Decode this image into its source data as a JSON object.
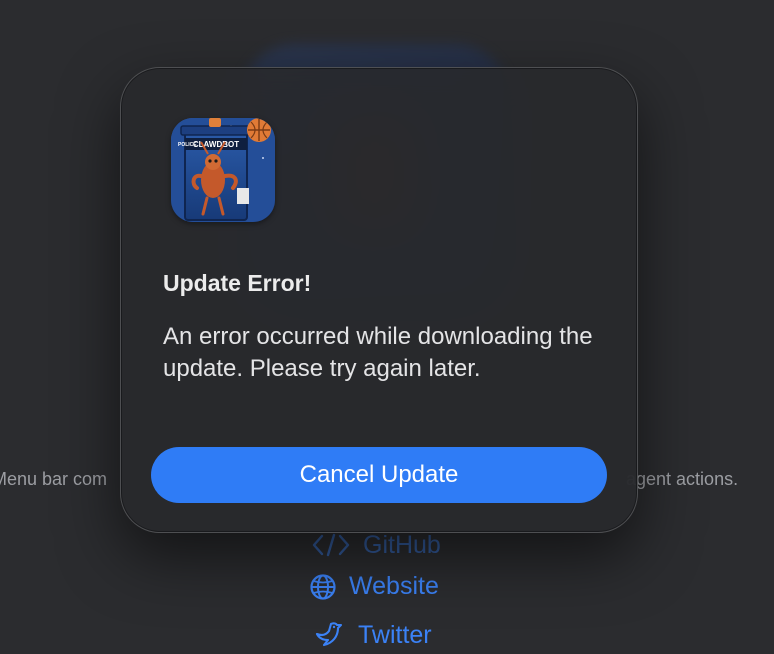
{
  "background": {
    "left_text": "Menu bar com",
    "right_text": "agent actions.",
    "links": [
      {
        "label": "GitHub",
        "icon": "code-icon"
      },
      {
        "label": "Website",
        "icon": "globe-icon"
      },
      {
        "label": "Twitter",
        "icon": "bird-icon"
      }
    ]
  },
  "dialog": {
    "icon": "clawdbot-app-icon",
    "icon_text": {
      "sign": "CLAWDBOT",
      "side": "POLICE"
    },
    "title": "Update Error!",
    "message": "An error occurred while downloading the update. Please try again later.",
    "button_label": "Cancel Update"
  },
  "colors": {
    "accent": "#2f7cf6",
    "link": "#3b82f6",
    "background": "#2b2c2f",
    "dialog": "#28292c"
  }
}
